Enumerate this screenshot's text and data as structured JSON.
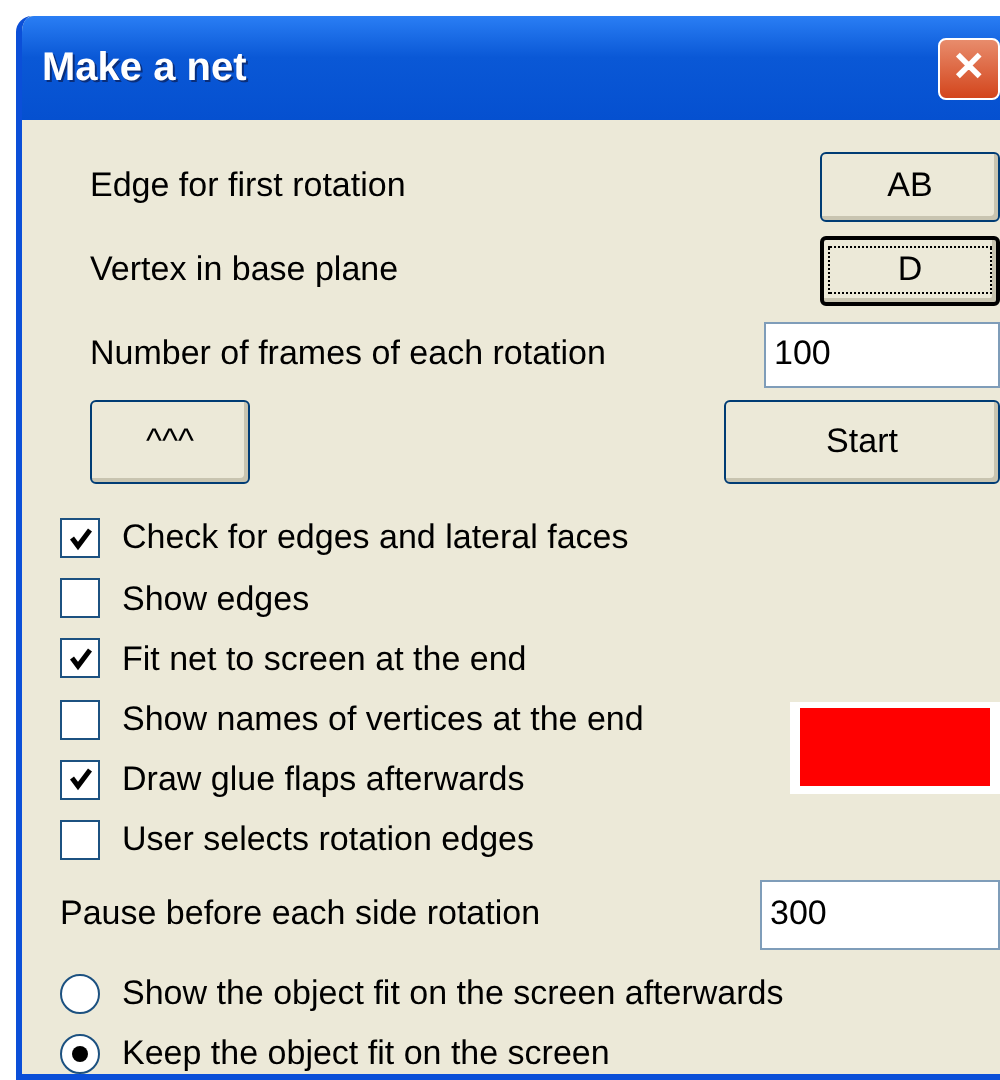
{
  "window": {
    "title": "Make a net",
    "close_label": "✕"
  },
  "settings": [
    {
      "kind": "button",
      "label": "Edge for first rotation",
      "value": "AB",
      "focused": false
    },
    {
      "kind": "button",
      "label": "Vertex in base plane",
      "value": "D",
      "focused": true
    },
    {
      "kind": "input",
      "label": "Number of frames of each rotation",
      "value": "100"
    }
  ],
  "actions": [
    {
      "label": "^^^"
    },
    {
      "label": "Start"
    }
  ],
  "options": [
    {
      "label": "Check for edges and lateral faces",
      "checked": true
    },
    {
      "label": "Show edges",
      "checked": false
    },
    {
      "label": "Fit net to screen at the end",
      "checked": true
    },
    {
      "label": "Show names of vertices at the end",
      "checked": false
    },
    {
      "label": "Draw glue flaps afterwards",
      "checked": true
    },
    {
      "label": "User selects rotation edges",
      "checked": false
    }
  ],
  "glue_flap_swatch": {
    "color": "#ff0000"
  },
  "pause": {
    "label": "Pause before each side rotation",
    "value": "300"
  },
  "fit_modes": [
    {
      "label": "Show the object fit on the screen afterwards",
      "selected": false
    },
    {
      "label": "Keep the object fit on the screen",
      "selected": true
    }
  ]
}
